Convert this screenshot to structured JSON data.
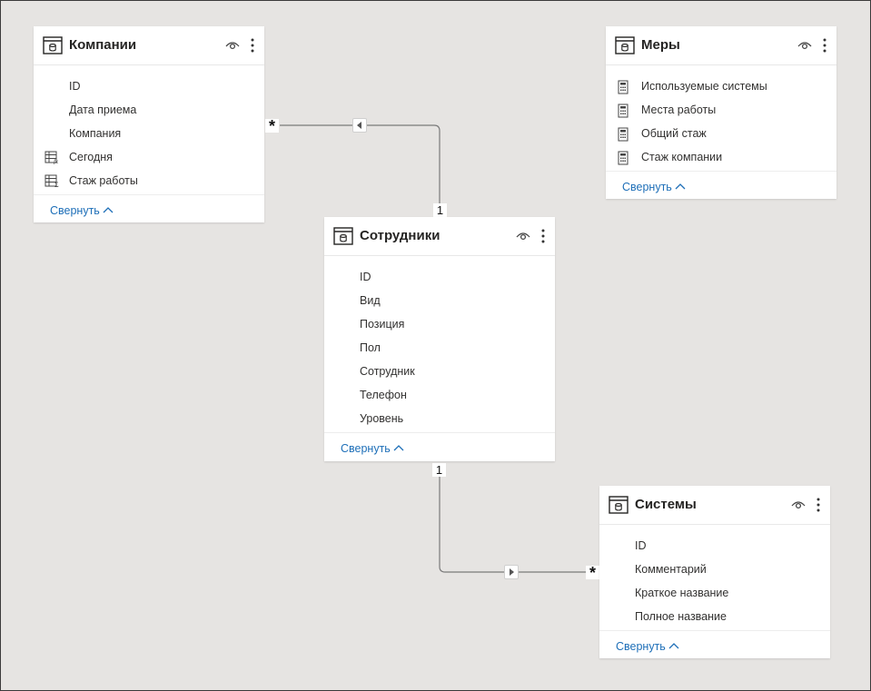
{
  "tables": {
    "companies": {
      "title": "Компании",
      "fields": [
        {
          "label": "ID",
          "icon": ""
        },
        {
          "label": "Дата приема",
          "icon": ""
        },
        {
          "label": "Компания",
          "icon": ""
        },
        {
          "label": "Сегодня",
          "icon": "calculated-column-icon"
        },
        {
          "label": "Стаж работы",
          "icon": "calculated-column-icon"
        }
      ],
      "collapse_label": "Свернуть"
    },
    "measures": {
      "title": "Меры",
      "fields": [
        {
          "label": "Используемые системы",
          "icon": "measure-calculator-icon"
        },
        {
          "label": "Места работы",
          "icon": "measure-calculator-icon"
        },
        {
          "label": "Общий стаж",
          "icon": "measure-calculator-icon"
        },
        {
          "label": "Стаж компании",
          "icon": "measure-calculator-icon"
        }
      ],
      "collapse_label": "Свернуть"
    },
    "employees": {
      "title": "Сотрудники",
      "fields": [
        {
          "label": "ID",
          "icon": ""
        },
        {
          "label": "Вид",
          "icon": ""
        },
        {
          "label": "Позиция",
          "icon": ""
        },
        {
          "label": "Пол",
          "icon": ""
        },
        {
          "label": "Сотрудник",
          "icon": ""
        },
        {
          "label": "Телефон",
          "icon": ""
        },
        {
          "label": "Уровень",
          "icon": ""
        }
      ],
      "collapse_label": "Свернуть"
    },
    "systems": {
      "title": "Системы",
      "fields": [
        {
          "label": "ID",
          "icon": ""
        },
        {
          "label": "Комментарий",
          "icon": ""
        },
        {
          "label": "Краткое название",
          "icon": ""
        },
        {
          "label": "Полное название",
          "icon": ""
        }
      ],
      "collapse_label": "Свернуть"
    }
  },
  "relationships": [
    {
      "from": "Компании",
      "to": "Сотрудники",
      "from_cardinality": "*",
      "to_cardinality": "1",
      "direction": "left"
    },
    {
      "from": "Сотрудники",
      "to": "Системы",
      "from_cardinality": "1",
      "to_cardinality": "*",
      "direction": "right"
    }
  ],
  "colors": {
    "canvas": "#e6e4e2",
    "card": "#ffffff",
    "link": "#1e6fb8",
    "line": "#777777"
  }
}
